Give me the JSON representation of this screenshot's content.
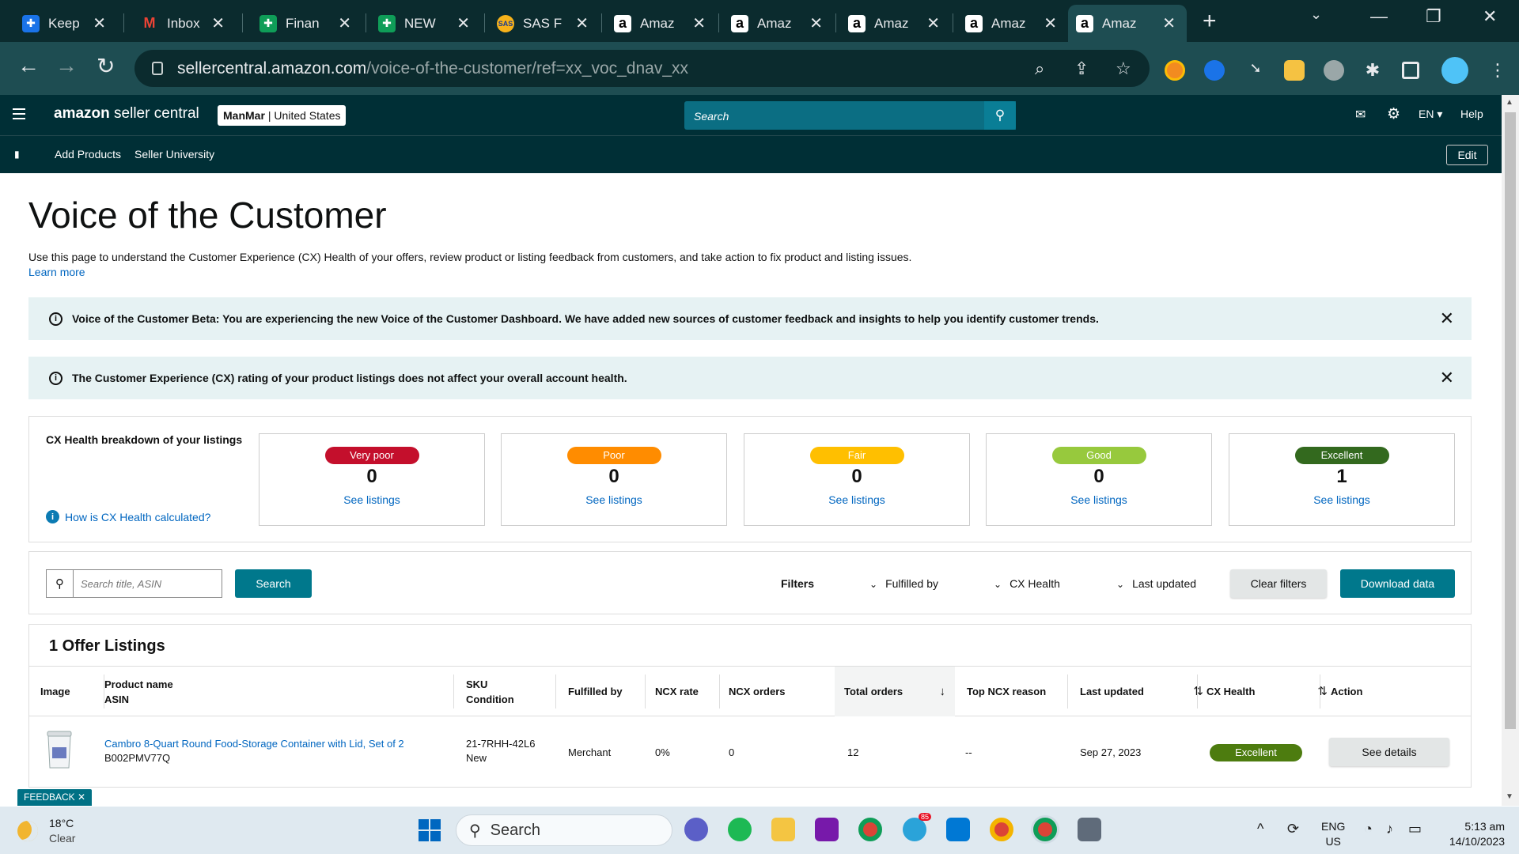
{
  "browser": {
    "tabs": [
      {
        "label": "Keep",
        "favicon": "keep-icon",
        "color": "#1a73e8"
      },
      {
        "label": "Inbox",
        "favicon": "gmail-icon",
        "color": "#ea4335"
      },
      {
        "label": "Finan",
        "favicon": "sheets-icon",
        "color": "#0f9d58"
      },
      {
        "label": "NEW",
        "favicon": "sheets-icon",
        "color": "#0f9d58"
      },
      {
        "label": "SAS F",
        "favicon": "sas-icon",
        "color": "#f7b21a"
      },
      {
        "label": "Amaz",
        "favicon": "amazon-icon",
        "color": "#000000"
      },
      {
        "label": "Amaz",
        "favicon": "amazon-icon",
        "color": "#000000"
      },
      {
        "label": "Amaz",
        "favicon": "amazon-icon",
        "color": "#000000"
      },
      {
        "label": "Amaz",
        "favicon": "amazon-icon",
        "color": "#000000"
      },
      {
        "label": "Amaz",
        "favicon": "amazon-icon",
        "color": "#000000"
      }
    ],
    "url_host": "sellercentral.amazon.com",
    "url_path": "/voice-of-the-customer/ref=xx_voc_dnav_xx"
  },
  "header": {
    "logo_bold": "amazon",
    "logo_rest": " seller central",
    "account_name": "ManMar",
    "account_region": "| United States",
    "search_placeholder": "Search",
    "lang": "EN",
    "help": "Help",
    "sublinks": [
      "Add Products",
      "Seller University"
    ],
    "edit": "Edit"
  },
  "page": {
    "title": "Voice of the Customer",
    "intro": "Use this page to understand the Customer Experience (CX) Health of your offers, review product or listing feedback from customers, and take action to fix product and listing issues.",
    "learn_more": "Learn more",
    "alerts": [
      "Voice of the Customer Beta: You are experiencing the new Voice of the Customer Dashboard. We have added new sources of customer feedback and insights to help you identify customer trends.",
      "The Customer Experience (CX) rating of your product listings does not affect your overall account health."
    ]
  },
  "cx_health": {
    "title": "CX Health breakdown of your listings",
    "how_link": "How is CX Health calculated?",
    "cards": [
      {
        "label": "Very poor",
        "count": "0",
        "link": "See listings",
        "color": "#c40f2c"
      },
      {
        "label": "Poor",
        "count": "0",
        "link": "See listings",
        "color": "#ff8c00"
      },
      {
        "label": "Fair",
        "count": "0",
        "link": "See listings",
        "color": "#ffbf00"
      },
      {
        "label": "Good",
        "count": "0",
        "link": "See listings",
        "color": "#97c93d"
      },
      {
        "label": "Excellent",
        "count": "1",
        "link": "See listings",
        "color": "#33691e"
      }
    ]
  },
  "filters": {
    "search_placeholder": "Search title, ASIN",
    "search_button": "Search",
    "filters_label": "Filters",
    "dropdowns": [
      "Fulfilled by",
      "CX Health",
      "Last updated"
    ],
    "clear": "Clear filters",
    "download": "Download data"
  },
  "listings": {
    "title": "1 Offer Listings",
    "columns": {
      "image": "Image",
      "product_name": "Product name",
      "asin": "ASIN",
      "sku": "SKU",
      "condition": "Condition",
      "fulfilled_by": "Fulfilled by",
      "ncx_rate": "NCX rate",
      "ncx_orders": "NCX orders",
      "total_orders": "Total orders",
      "top_reason": "Top NCX reason",
      "last_updated": "Last updated",
      "cx_health": "CX Health",
      "action": "Action"
    },
    "rows": [
      {
        "product_name": "Cambro 8-Quart Round Food-Storage Container with Lid, Set of 2",
        "asin": "B002PMV77Q",
        "sku": "21-7RHH-42L6",
        "condition": "New",
        "fulfilled_by": "Merchant",
        "ncx_rate": "0%",
        "ncx_orders": "0",
        "total_orders": "12",
        "top_reason": "--",
        "last_updated": "Sep 27, 2023",
        "cx_health": "Excellent",
        "action": "See details"
      }
    ]
  },
  "feedback_tab": "FEEDBACK ✕",
  "taskbar": {
    "temp": "18°C",
    "weather": "Clear",
    "search": "Search",
    "lang1": "ENG",
    "lang2": "US",
    "time": "5:13 am",
    "date": "14/10/2023",
    "badge": "85"
  }
}
